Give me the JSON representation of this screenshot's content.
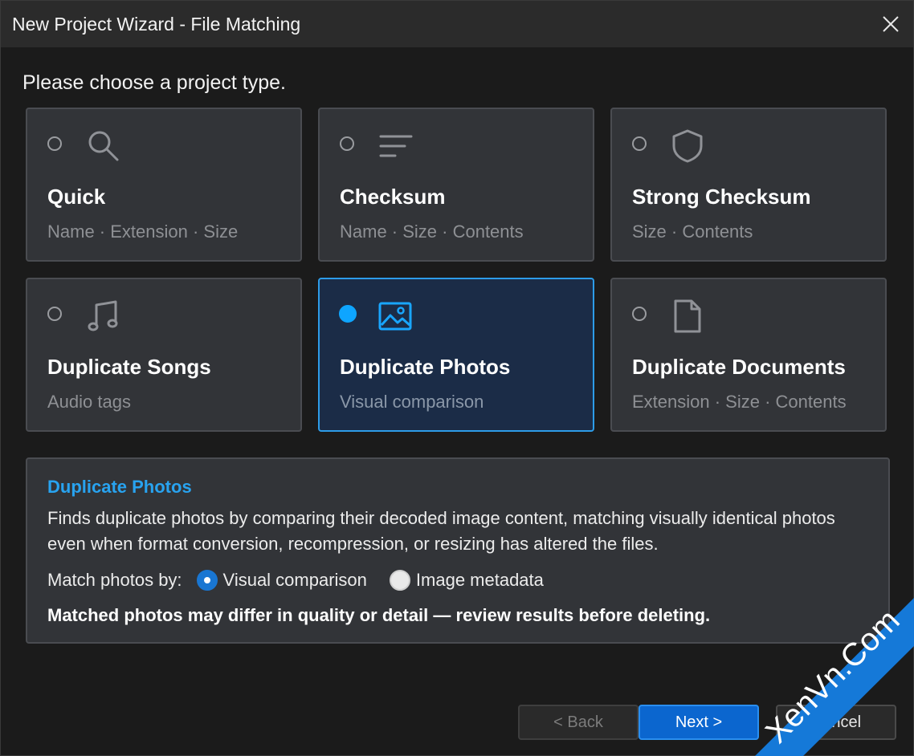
{
  "window": {
    "title": "New Project Wizard - File Matching"
  },
  "prompt": "Please choose a project type.",
  "cards": [
    {
      "title": "Quick",
      "subtitle": "Name · Extension · Size",
      "icon": "search-icon",
      "selected": false
    },
    {
      "title": "Checksum",
      "subtitle": "Name · Size · Contents",
      "icon": "lines-icon",
      "selected": false
    },
    {
      "title": "Strong Checksum",
      "subtitle": "Size · Contents",
      "icon": "shield-icon",
      "selected": false
    },
    {
      "title": "Duplicate Songs",
      "subtitle": "Audio tags",
      "icon": "music-note-icon",
      "selected": false
    },
    {
      "title": "Duplicate Photos",
      "subtitle": "Visual comparison",
      "icon": "image-icon",
      "selected": true
    },
    {
      "title": "Duplicate Documents",
      "subtitle": "Extension · Size · Contents",
      "icon": "document-icon",
      "selected": false
    }
  ],
  "details": {
    "title": "Duplicate Photos",
    "description": "Finds duplicate photos by comparing their decoded image content, matching visually identical photos even when format conversion, recompression, or resizing has altered the files.",
    "match_label": "Match photos by:",
    "options": [
      {
        "label": "Visual comparison",
        "checked": true
      },
      {
        "label": "Image metadata",
        "checked": false
      }
    ],
    "warning": "Matched photos may differ in quality or detail — review results before deleting."
  },
  "buttons": {
    "back": "< Back",
    "next": "Next >",
    "cancel": "Cancel"
  },
  "watermark": {
    "text": "XenVn.Com"
  },
  "colors": {
    "accent": "#0ea5ff",
    "selected_card_bg": "#1b2c47",
    "card_bg": "#323438",
    "primary_button": "#0b66cf",
    "details_title": "#28a3f0",
    "watermark_bg": "#1579d8"
  }
}
